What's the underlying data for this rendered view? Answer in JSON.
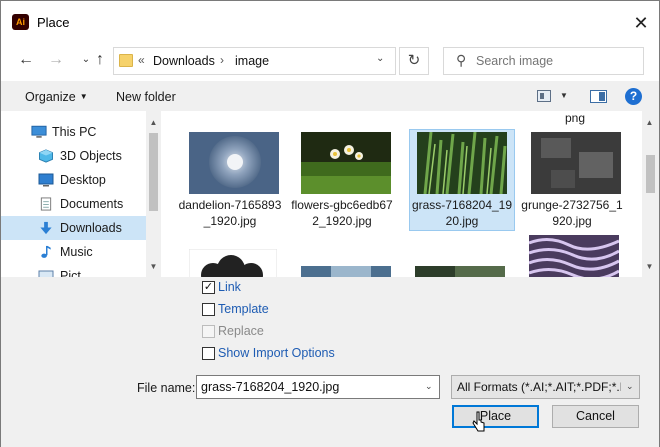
{
  "window": {
    "app_icon": "Ai",
    "title": "Place"
  },
  "address": {
    "overflow": "«",
    "crumbs": [
      "Downloads",
      "image"
    ],
    "search_placeholder": "Search image"
  },
  "toolbar": {
    "organize": "Organize",
    "new_folder": "New folder"
  },
  "nav": {
    "items": [
      {
        "label": "This PC",
        "icon": "computer-icon"
      },
      {
        "label": "3D Objects",
        "icon": "cube-icon"
      },
      {
        "label": "Desktop",
        "icon": "desktop-icon"
      },
      {
        "label": "Documents",
        "icon": "document-icon"
      },
      {
        "label": "Downloads",
        "icon": "download-arrow-icon",
        "selected": true
      },
      {
        "label": "Music",
        "icon": "music-note-icon"
      },
      {
        "label": "Pict",
        "icon": "pictures-icon"
      }
    ]
  },
  "files": {
    "partial_label": "png",
    "tiles": [
      {
        "label": "dandelion-7165893_1920.jpg",
        "thumb": "dandelion"
      },
      {
        "label": "flowers-gbc6edb672_1920.jpg",
        "thumb": "flowers"
      },
      {
        "label": "grass-7168204_1920.jpg",
        "thumb": "grass",
        "selected": true
      },
      {
        "label": "grunge-2732756_1920.jpg",
        "thumb": "grunge"
      }
    ]
  },
  "options": {
    "link": {
      "label": "Link",
      "checked": true
    },
    "template": {
      "label": "Template",
      "checked": false
    },
    "replace": {
      "label": "Replace",
      "checked": false,
      "disabled": true
    },
    "show_import": {
      "label": "Show Import Options",
      "checked": false
    }
  },
  "file_name": {
    "label": "File name:",
    "value": "grass-7168204_1920.jpg"
  },
  "format": {
    "value": "All Formats (*.AI;*.AIT;*.PDF;*.D"
  },
  "buttons": {
    "place": "Place",
    "cancel": "Cancel"
  },
  "colors": {
    "accent": "#0078d7",
    "selection": "#cce4f7",
    "link": "#1e5cb3"
  }
}
